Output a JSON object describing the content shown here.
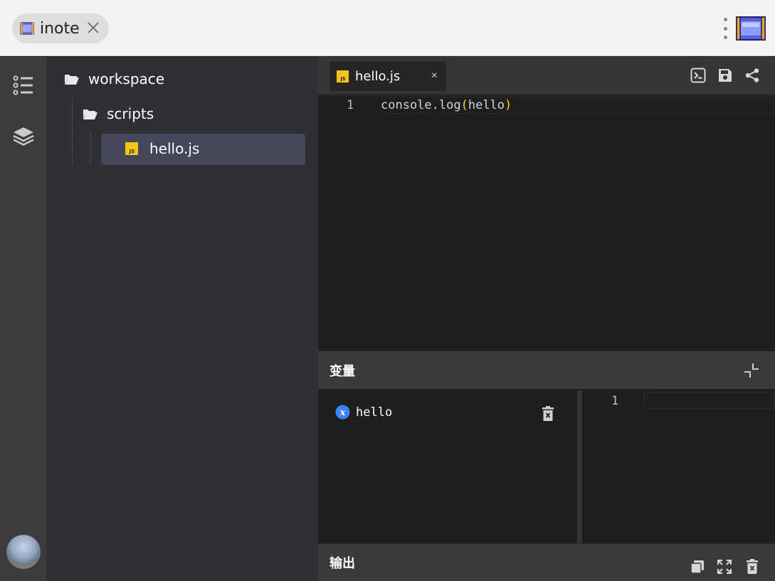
{
  "browser": {
    "tab_label": "inote",
    "tab_icon": "film-strip-icon",
    "app_logo": "film-strip-logo"
  },
  "activity_bar": {
    "items": [
      {
        "icon": "outline-list-icon"
      },
      {
        "icon": "layers-icon"
      }
    ],
    "avatar": "user-avatar"
  },
  "explorer": {
    "root": {
      "label": "workspace",
      "icon": "folder-open-icon"
    },
    "folder": {
      "label": "scripts",
      "icon": "folder-open-icon"
    },
    "file": {
      "label": "hello.js",
      "icon": "js-file-icon",
      "selected": true
    }
  },
  "editor": {
    "tab": {
      "label": "hello.js",
      "close": "×"
    },
    "toolbar": [
      {
        "icon": "run-code-icon"
      },
      {
        "icon": "save-icon"
      },
      {
        "icon": "share-icon"
      }
    ],
    "lines": [
      {
        "number": "1",
        "before": "console.log",
        "open": "(",
        "arg": "hello",
        "close": ")"
      }
    ]
  },
  "variables_panel": {
    "title": "变量",
    "collapse_icon": "minimize-icon",
    "items": [
      {
        "name": "hello",
        "icon": "variable-icon"
      }
    ],
    "preview_line": "1"
  },
  "output_panel": {
    "title": "输出",
    "actions": [
      {
        "icon": "copy-icon"
      },
      {
        "icon": "fullscreen-icon"
      },
      {
        "icon": "clear-icon"
      }
    ]
  },
  "colors": {
    "accent_selected": "#45465a",
    "js_badge": "#f5c518",
    "paren": "#ffd700",
    "variable_badge": "#3b82f6"
  }
}
